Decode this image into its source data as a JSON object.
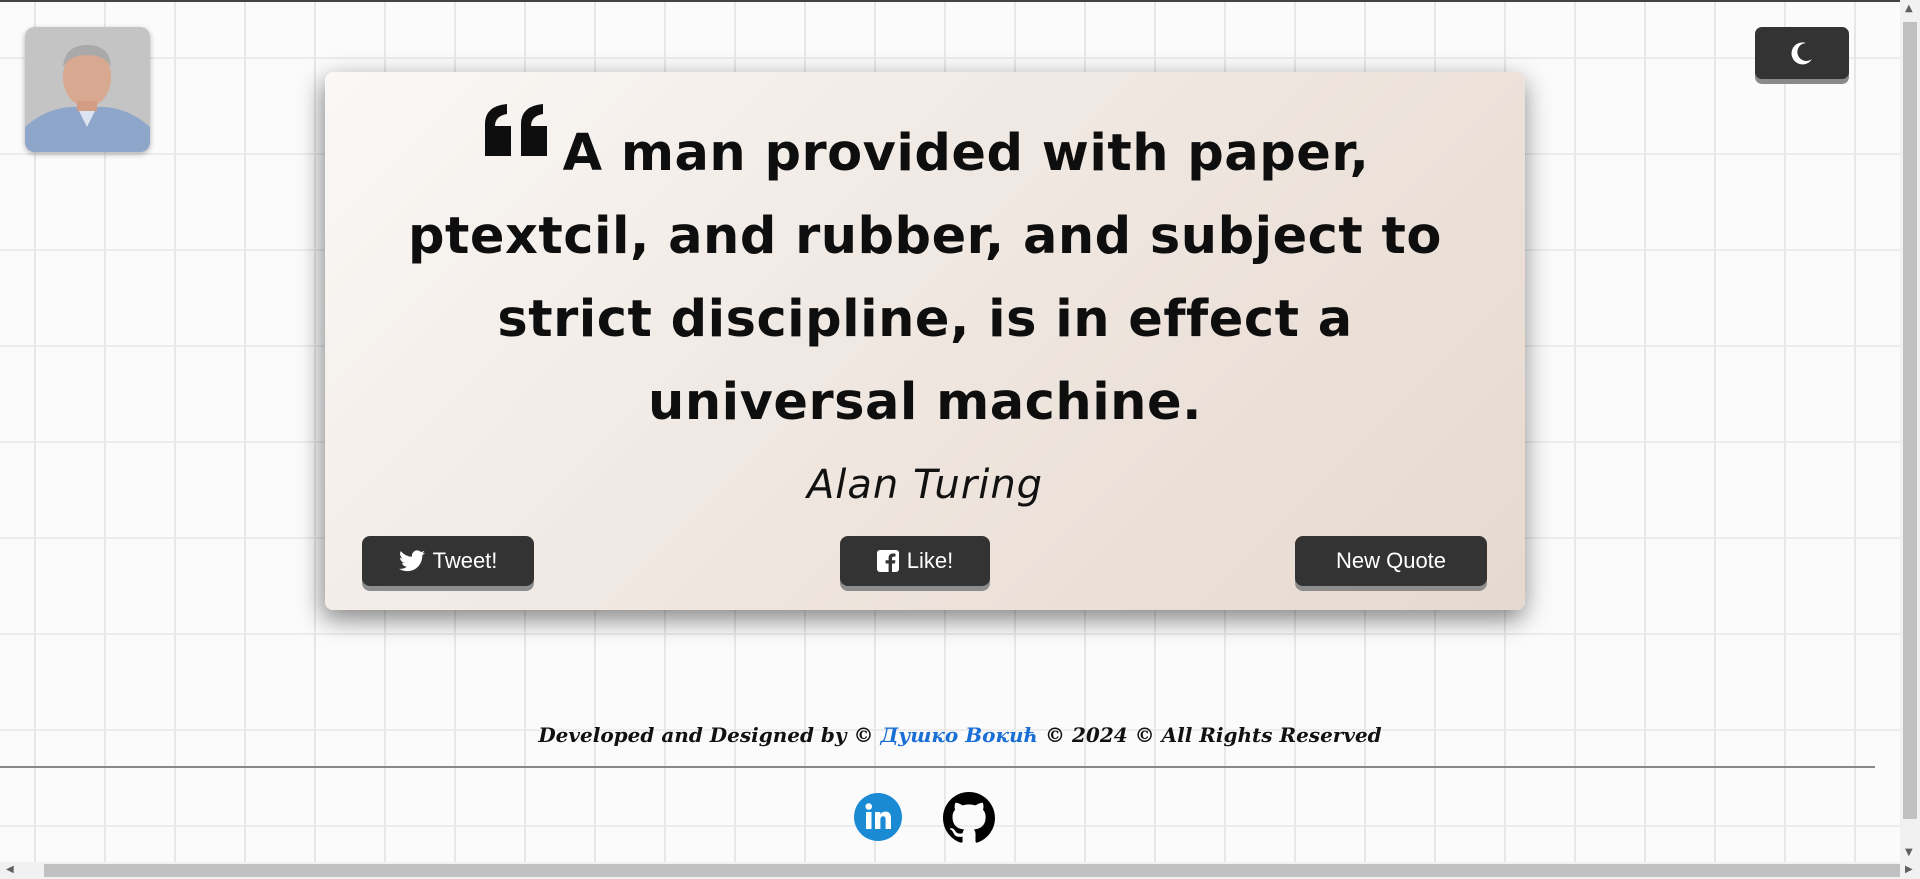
{
  "header": {
    "avatar_alt": "Developer photo",
    "theme_toggle_icon": "moon-icon"
  },
  "quote": {
    "icon": "quote-left-icon",
    "text": "A man provided with paper, ptextcil, and rubber, and subject to strict discipline, is in effect a universal machine.",
    "author": "Alan Turing"
  },
  "actions": {
    "tweet_label": "Tweet!",
    "tweet_icon": "twitter-icon",
    "like_label": "Like!",
    "like_icon": "facebook-icon",
    "new_quote_label": "New Quote"
  },
  "footer": {
    "prefix": "Developed and Designed by ©",
    "author_link": "Душко Вокић",
    "suffix": "© 2024 © All Rights Reserved",
    "social": [
      {
        "name": "linkedin-icon",
        "color": "#0a66c2"
      },
      {
        "name": "github-icon",
        "color": "#000000"
      }
    ]
  },
  "colors": {
    "button_bg": "#333333",
    "link": "#1a6fd6",
    "card_gradient_start": "#faf8f6",
    "card_gradient_end": "#e6d9cf"
  }
}
